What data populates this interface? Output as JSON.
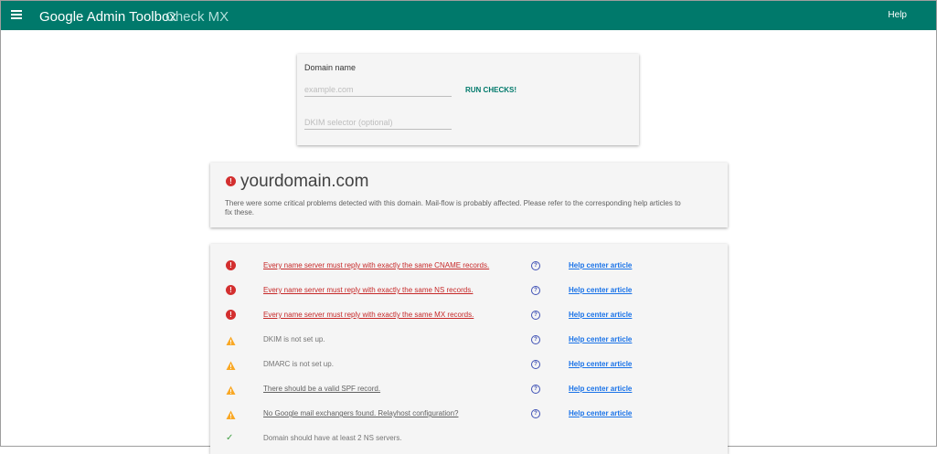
{
  "header": {
    "title": "Google Admin Toolbox",
    "subtitle": "Check MX",
    "help_label": "Help",
    "bar_color": "#00796b"
  },
  "form": {
    "domain_label": "Domain name",
    "domain_placeholder": "example.com",
    "domain_value": "",
    "dkim_placeholder": "DKIM selector (optional)",
    "dkim_value": "",
    "run_label": "RUN CHECKS!"
  },
  "summary": {
    "domain": "yourdomain.com",
    "status_icon": "error-icon",
    "message": "There were some critical problems detected with this domain. Mail-flow is probably affected. Please refer to the corresponding help articles to fix these."
  },
  "checks": [
    {
      "status": "error",
      "text": "Every name server must reply with exactly the same CNAME records.",
      "has_help": true,
      "help_label": "Help center article"
    },
    {
      "status": "error",
      "text": "Every name server must reply with exactly the same NS records.",
      "has_help": true,
      "help_label": "Help center article"
    },
    {
      "status": "error",
      "text": "Every name server must reply with exactly the same MX records.",
      "has_help": true,
      "help_label": "Help center article"
    },
    {
      "status": "warning",
      "text": "DKIM is not set up.",
      "has_help": true,
      "help_label": "Help center article"
    },
    {
      "status": "warning",
      "text": "DMARC is not set up.",
      "has_help": true,
      "help_label": "Help center article"
    },
    {
      "status": "warning-link",
      "text": "There should be a valid SPF record.",
      "has_help": true,
      "help_label": "Help center article"
    },
    {
      "status": "warning-link",
      "text": "No Google mail exchangers found. Relayhost configuration?",
      "has_help": true,
      "help_label": "Help center article"
    },
    {
      "status": "ok",
      "text": "Domain should have at least 2 NS servers.",
      "has_help": false
    }
  ],
  "colors": {
    "error": "#d32f2f",
    "warning": "#f9a825",
    "ok": "#43a047",
    "link": "#1a73e8"
  }
}
